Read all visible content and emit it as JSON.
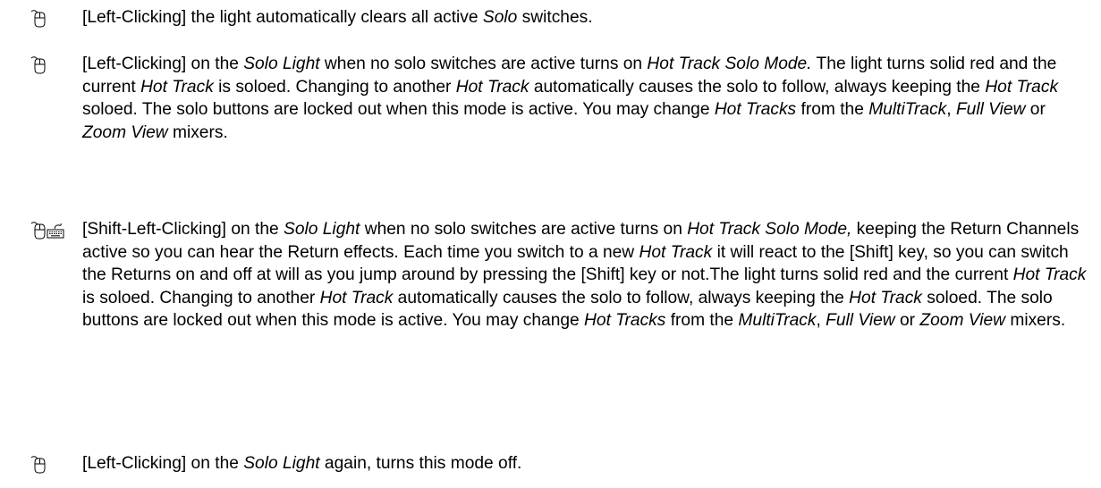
{
  "icons": {
    "mouse": "mouse-icon",
    "keyboard": "keyboard-icon"
  },
  "entries": [
    {
      "segments": [
        {
          "t": "[Left-Clicking] the light automatically clears all active "
        },
        {
          "t": "Solo",
          "i": true
        },
        {
          "t": " switches."
        }
      ]
    },
    {
      "segments": [
        {
          "t": "[Left-Clicking] on the "
        },
        {
          "t": "Solo Light",
          "i": true
        },
        {
          "t": " when no solo switches are active turns on "
        },
        {
          "t": "Hot Track Solo Mode.",
          "i": true
        },
        {
          "t": " The light turns solid red and the current "
        },
        {
          "t": "Hot Track",
          "i": true
        },
        {
          "t": " is soloed. Changing to another "
        },
        {
          "t": "Hot Track",
          "i": true
        },
        {
          "t": " automatically causes the solo to follow, always keeping the "
        },
        {
          "t": "Hot Track",
          "i": true
        },
        {
          "t": " soloed. The solo buttons are locked out when this mode is active. You may change "
        },
        {
          "t": "Hot Tracks",
          "i": true
        },
        {
          "t": " from the "
        },
        {
          "t": "MultiTrack",
          "i": true
        },
        {
          "t": ", "
        },
        {
          "t": "Full View",
          "i": true
        },
        {
          "t": " or "
        },
        {
          "t": "Zoom View",
          "i": true
        },
        {
          "t": " mixers."
        }
      ]
    },
    {
      "segments": [
        {
          "t": "[Shift-Left-Clicking] on the "
        },
        {
          "t": "Solo Light",
          "i": true
        },
        {
          "t": " when no solo switches are active turns on "
        },
        {
          "t": "Hot Track Solo Mode,",
          "i": true
        },
        {
          "t": " keeping the Return Channels active so you can hear the Return effects. Each time you switch to a new "
        },
        {
          "t": "Hot Track",
          "i": true
        },
        {
          "t": " it will react to the [Shift] key, so you can switch the Returns on and off at will as you jump around by pressing the [Shift] key or not.The light turns solid red and the current "
        },
        {
          "t": "Hot Track",
          "i": true
        },
        {
          "t": " is soloed. Changing to another "
        },
        {
          "t": "Hot Track",
          "i": true
        },
        {
          "t": " automatically causes the solo to follow, always keeping the "
        },
        {
          "t": "Hot Track",
          "i": true
        },
        {
          "t": " soloed. The solo buttons are locked out when this mode is active. You may change "
        },
        {
          "t": "Hot Tracks",
          "i": true
        },
        {
          "t": " from the "
        },
        {
          "t": "MultiTrack",
          "i": true
        },
        {
          "t": ", "
        },
        {
          "t": "Full View",
          "i": true
        },
        {
          "t": " or "
        },
        {
          "t": "Zoom View",
          "i": true
        },
        {
          "t": " mixers."
        }
      ]
    },
    {
      "segments": [
        {
          "t": "[Left-Clicking] on the "
        },
        {
          "t": "Solo Light",
          "i": true
        },
        {
          "t": " again, turns this mode off."
        }
      ]
    }
  ]
}
